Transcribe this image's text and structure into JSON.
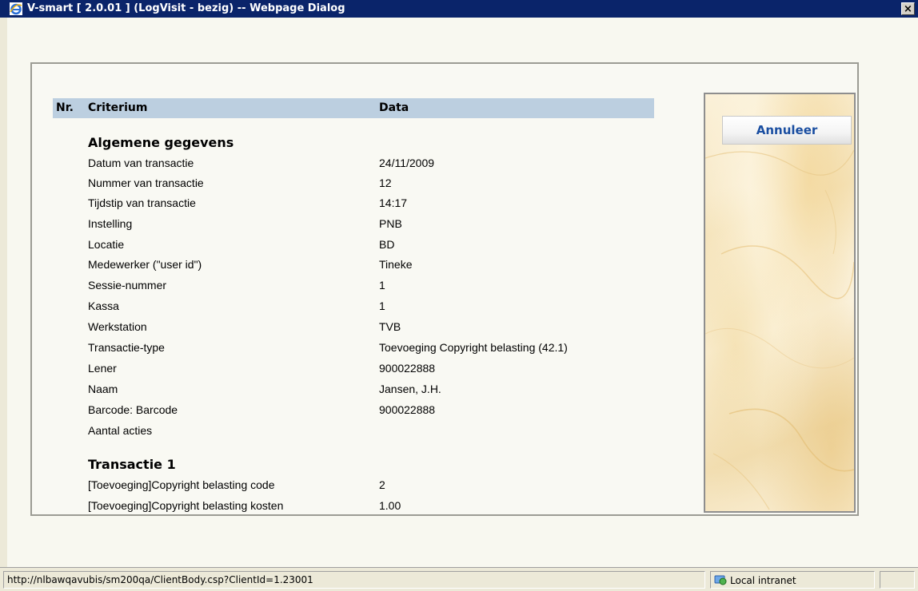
{
  "window": {
    "title": "V-smart [ 2.0.01 ] (LogVisit - bezig) -- Webpage Dialog",
    "close_glyph": "×",
    "titlebar_color": "#0a246a"
  },
  "table": {
    "headers": {
      "nr": "Nr.",
      "criterium": "Criterium",
      "data": "Data"
    },
    "header_color": "#bccfe0"
  },
  "sections": [
    {
      "title": "Algemene gegevens",
      "rows": [
        {
          "criterium": "Datum van transactie",
          "data": "24/11/2009"
        },
        {
          "criterium": "Nummer van transactie",
          "data": "12"
        },
        {
          "criterium": "Tijdstip van transactie",
          "data": "14:17"
        },
        {
          "criterium": "Instelling",
          "data": "PNB"
        },
        {
          "criterium": "Locatie",
          "data": "BD"
        },
        {
          "criterium": "Medewerker (\"user id\")",
          "data": "Tineke"
        },
        {
          "criterium": "Sessie-nummer",
          "data": "1"
        },
        {
          "criterium": "Kassa",
          "data": "1"
        },
        {
          "criterium": "Werkstation",
          "data": "TVB"
        },
        {
          "criterium": "Transactie-type",
          "data": "Toevoeging Copyright belasting (42.1)"
        },
        {
          "criterium": "Lener",
          "data": "900022888"
        },
        {
          "criterium": "Naam",
          "data": "Jansen, J.H."
        },
        {
          "criterium": "Barcode: Barcode",
          "data": "900022888"
        },
        {
          "criterium": "Aantal acties",
          "data": ""
        }
      ]
    },
    {
      "title": "Transactie 1",
      "rows": [
        {
          "criterium": "[Toevoeging]Copyright belasting code",
          "data": "2"
        },
        {
          "criterium": "[Toevoeging]Copyright belasting kosten",
          "data": "1.00"
        }
      ]
    }
  ],
  "actions": {
    "cancel_label": "Annuleer",
    "cancel_color": "#1a4ea1"
  },
  "statusbar": {
    "url": "http://nlbawqavubis/sm200qa/ClientBody.csp?ClientId=1.23001",
    "zone": "Local intranet"
  },
  "icons": {
    "app": "ie-icon",
    "zone": "local-intranet-icon",
    "close": "close-icon"
  }
}
